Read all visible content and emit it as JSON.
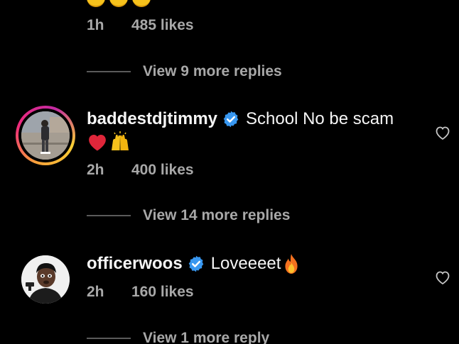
{
  "top_comment": {
    "time": "1h",
    "likes": "485 likes",
    "view_replies": "View 9 more replies"
  },
  "comment_timmy": {
    "username": "baddestdjtimmy",
    "text": "School No be scam",
    "emojis": [
      "red-heart-emoji",
      "raising-hands-emoji"
    ],
    "time": "2h",
    "likes": "400 likes",
    "view_replies": "View 14 more replies"
  },
  "comment_woos": {
    "username": "officerwoos",
    "text": "Loveeeet",
    "emoji": "fire-emoji",
    "time": "2h",
    "likes": "160 likes",
    "view_replies": "View 1 more reply"
  },
  "colors": {
    "background": "#000000",
    "text_primary": "#f5f5f5",
    "text_secondary": "#a8a8a8",
    "verified_badge": "#3897f0",
    "story_ring_start": "#f9ce34",
    "story_ring_end": "#c32aa3"
  }
}
